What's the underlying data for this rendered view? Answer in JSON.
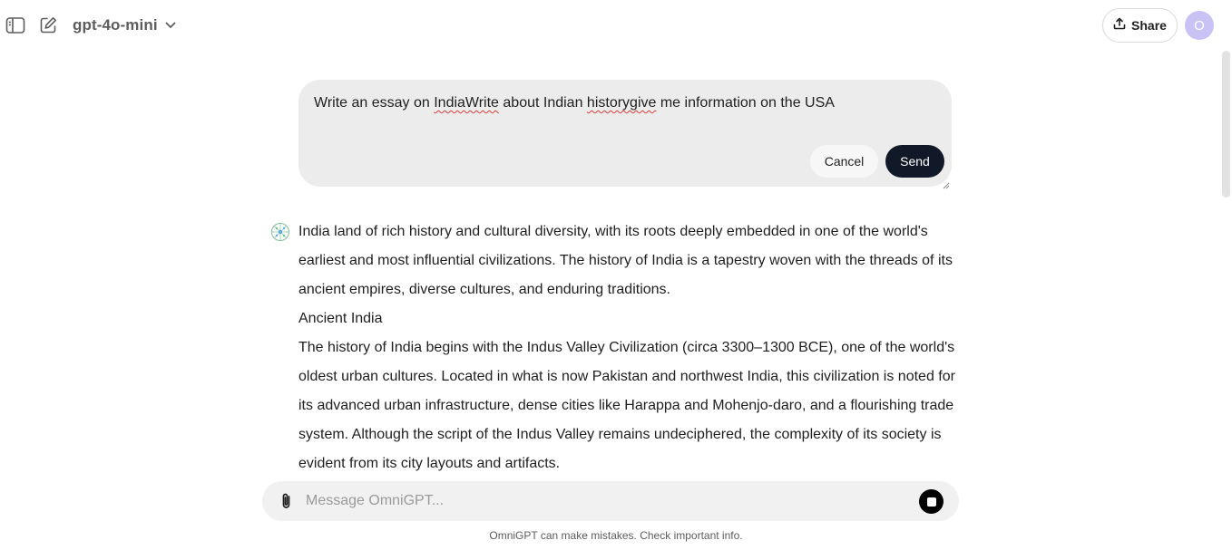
{
  "header": {
    "model_name": "gpt-4o-mini",
    "share_label": "Share",
    "avatar_initial": "O"
  },
  "edit": {
    "text_parts": [
      "Write an essay on ",
      "IndiaWrite",
      " about Indian ",
      "historygive",
      " me information on the USA"
    ],
    "cancel_label": "Cancel",
    "send_label": "Send"
  },
  "answer": {
    "paragraphs": [
      "India land of rich history and cultural diversity, with its roots deeply embedded in one of the world's earliest and most influential civilizations. The history of India is a tapestry woven with the threads of its ancient empires, diverse cultures, and enduring traditions.",
      "Ancient India",
      "The history of India begins with the Indus Valley Civilization (circa 3300–1300 BCE), one of the world's oldest urban cultures. Located in what is now Pakistan and northwest India, this civilization is noted for its advanced urban infrastructure, dense cities like Harappa and Mohenjo-daro, and a flourishing trade system. Although the script of the Indus Valley remains undeciphered, the complexity of its society is evident from its city layouts and artifacts."
    ]
  },
  "composer": {
    "placeholder": "Message OmniGPT...",
    "value": ""
  },
  "footer": {
    "disclaimer": "OmniGPT can make mistakes. Check important info."
  },
  "icons": {
    "sidebar_toggle": "sidebar-icon",
    "new_chat": "edit-icon",
    "model_dropdown": "chevron-down-icon",
    "share": "upload-icon",
    "assistant": "omnigpt-logo-icon",
    "attach": "paperclip-icon",
    "stop": "stop-icon"
  },
  "colors": {
    "send_button": "#111827",
    "avatar_bg": "#c9c2f5",
    "edit_box_bg": "#ececec",
    "composer_bg": "#f1f1f1"
  }
}
